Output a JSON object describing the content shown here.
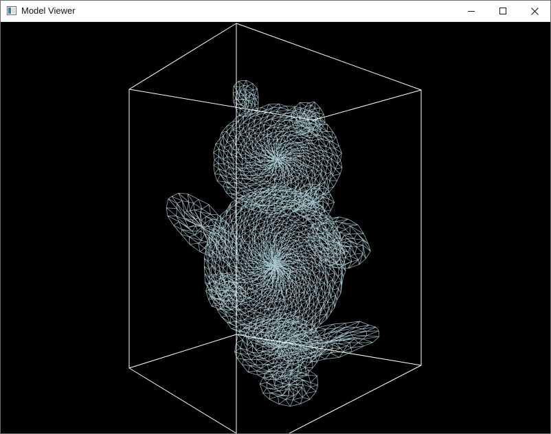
{
  "window": {
    "title": "Model Viewer"
  },
  "icons": {
    "app": "app-window-icon",
    "minimize": "minimize-icon",
    "maximize": "maximize-icon",
    "close": "close-icon"
  },
  "colors": {
    "viewport_background": "#000000",
    "bounding_box": "#ffffff",
    "mesh_wire": "#a6c4cc"
  },
  "scene": {
    "render_mode": "wireframe",
    "model": "teddy-bear-mesh",
    "bounding_box_visible": true
  }
}
